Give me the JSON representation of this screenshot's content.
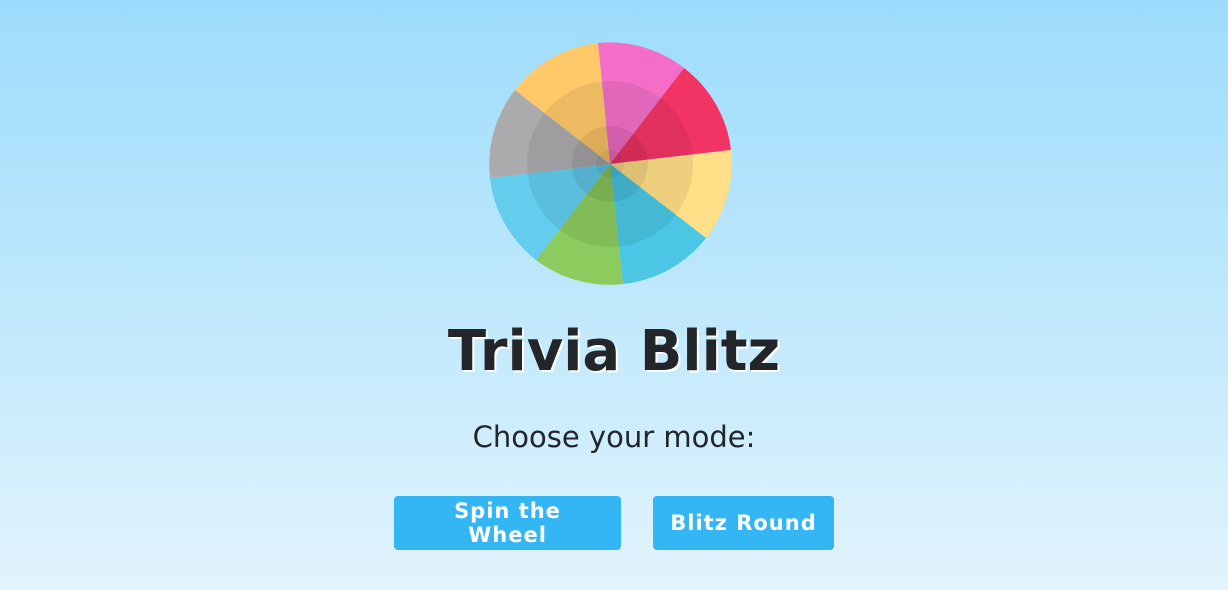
{
  "app": {
    "title": "Trivia Blitz",
    "subtitle": "Choose your mode:"
  },
  "modes": {
    "spin_label": "Spin the Wheel",
    "blitz_label": "Blitz Round"
  },
  "colors": {
    "button": "#34b6f5",
    "title_text": "#22252a",
    "wheel_segments": [
      "#f46ec8",
      "#f23465",
      "#ffdf88",
      "#4bc6e4",
      "#8ccb5e",
      "#64cdee",
      "#ababad",
      "#ffc969"
    ]
  },
  "wheel": {
    "segment_count": 8,
    "icon": "category-wheel-icon"
  }
}
